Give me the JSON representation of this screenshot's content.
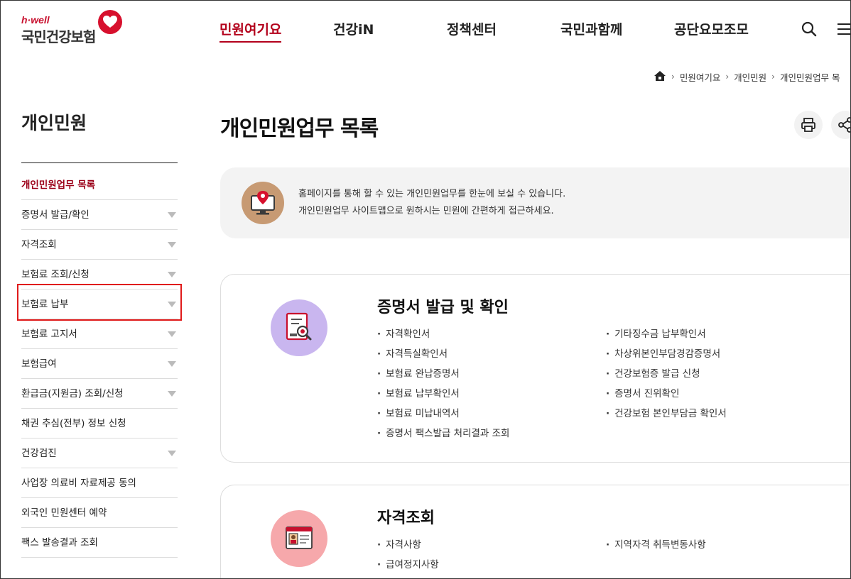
{
  "header": {
    "logo_tag": "h·well",
    "logo_name": "국민건강보험",
    "nav": [
      "민원여기요",
      "건강iN",
      "정책센터",
      "국민과함께",
      "공단요모조모"
    ],
    "active_nav": "민원여기요",
    "accent_color": "#b3001b"
  },
  "breadcrumb": [
    "민원여기요",
    "개인민원",
    "개인민원업무 목"
  ],
  "sidebar": {
    "title": "개인민원",
    "items": [
      {
        "label": "개인민원업무 목록",
        "active": true,
        "has_arrow": false
      },
      {
        "label": "증명서 발급/확인",
        "has_arrow": true
      },
      {
        "label": "자격조회",
        "has_arrow": true
      },
      {
        "label": "보험료 조회/신청",
        "has_arrow": true
      },
      {
        "label": "보험료 납부",
        "has_arrow": true,
        "highlighted": true
      },
      {
        "label": "보험료 고지서",
        "has_arrow": true
      },
      {
        "label": "보험급여",
        "has_arrow": true
      },
      {
        "label": "환급금(지원금) 조회/신청",
        "has_arrow": true
      },
      {
        "label": "채권 추심(전부) 정보 신청",
        "has_arrow": false
      },
      {
        "label": "건강검진",
        "has_arrow": true
      },
      {
        "label": "사업장 의료비 자료제공 동의",
        "has_arrow": false
      },
      {
        "label": "외국인 민원센터 예약",
        "has_arrow": false
      },
      {
        "label": "팩스 발송결과 조회",
        "has_arrow": false
      }
    ]
  },
  "main": {
    "title": "개인민원업무 목록",
    "notice_line1": "홈페이지를 통해 할 수 있는 개인민원업무를 한눈에 보실 수 있습니다.",
    "notice_line2": "개인민원업무 사이트맵으로 원하시는 민원에 간편하게 접근하세요.",
    "cards": [
      {
        "title": "증명서 발급 및 확인",
        "icon": "certificate-search-icon",
        "icon_bg": "#c9b6ef",
        "left": [
          "자격확인서",
          "자격득실확인서",
          "보험료 완납증명서",
          "보험료 납부확인서",
          "보험료 미납내역서",
          "증명서 팩스발급 처리결과 조회"
        ],
        "right": [
          "기타징수금 납부확인서",
          "차상위본인부담경감증명서",
          "건강보험증 발급 신청",
          "증명서 진위확인",
          "건강보험 본인부담금 확인서"
        ]
      },
      {
        "title": "자격조회",
        "icon": "id-card-icon",
        "icon_bg": "#f6a8ab",
        "left": [
          "자격사항",
          "급여정지사항"
        ],
        "right": [
          "지역자격 취득변동사항"
        ]
      }
    ]
  }
}
